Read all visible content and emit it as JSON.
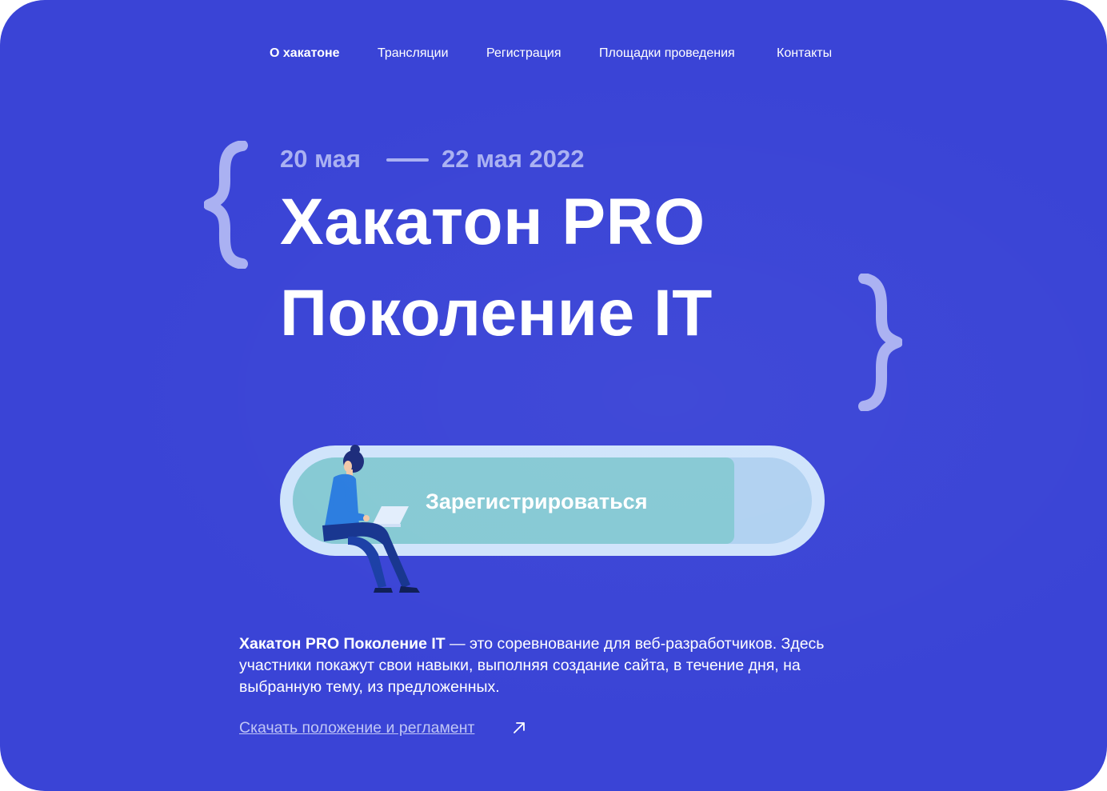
{
  "nav": {
    "items": [
      {
        "label": "О хакатоне",
        "active": true
      },
      {
        "label": "Трансляции",
        "active": false
      },
      {
        "label": "Регистрация",
        "active": false
      },
      {
        "label": "Площадки проведения",
        "active": false
      },
      {
        "label": "Контакты",
        "active": false
      }
    ]
  },
  "hero": {
    "date_start": "20 мая",
    "date_end": "22 мая 2022",
    "title_line1": "Хакатон PRO",
    "title_line2": "Поколение IT",
    "decor": {
      "left": "brace-left-icon",
      "right": "brace-right-icon"
    }
  },
  "cta": {
    "label": "Зарегистрироваться",
    "illustration": "person-with-laptop-illustration"
  },
  "description": {
    "lead": "Хакатон PRO Поколение IT",
    "text": " — это соревнование для веб-разработчиков. Здесь участники покажут свои навыки, выполняя создание сайта, в течение дня, на выбранную тему, из предложенных."
  },
  "download": {
    "label": "Скачать положение и регламент",
    "icon": "arrow-up-right-icon"
  },
  "colors": {
    "background": "#3a44d6",
    "accent_light": "#aab1f2",
    "cta_outer": "#cfe4fb",
    "cta_track": "#b0d1f1",
    "cta_button": "#86c9d4"
  }
}
